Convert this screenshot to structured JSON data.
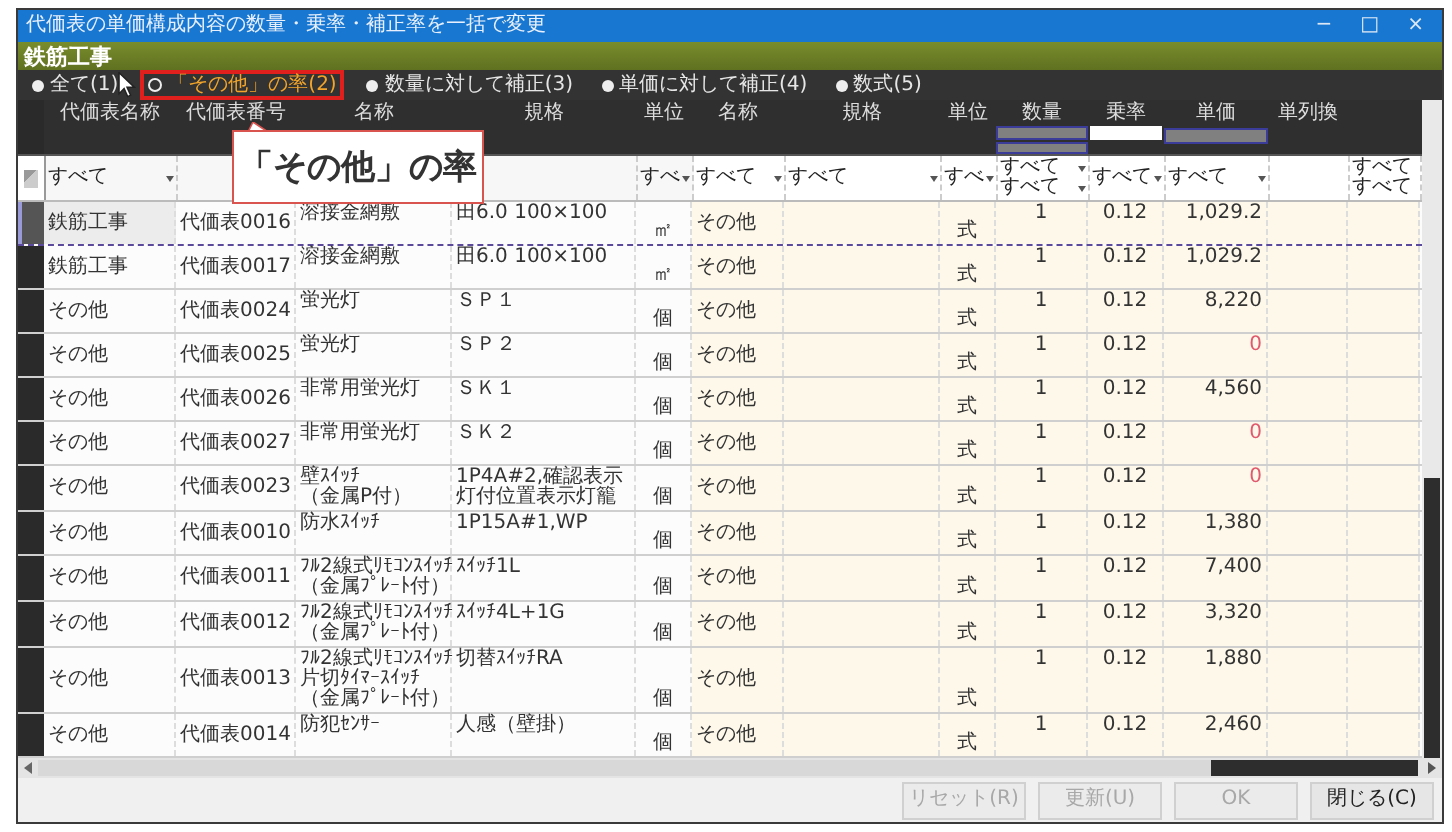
{
  "window": {
    "title": "代価表の単価構成内容の数量・乗率・補正率を一括で変更",
    "controls": [
      "−",
      "□",
      "×"
    ]
  },
  "category": "鉄筋工事",
  "modes": [
    {
      "label": "全て(1)",
      "selected": false,
      "highlighted": false
    },
    {
      "label": "「その他」の率(2)",
      "selected": true,
      "highlighted": true
    },
    {
      "label": "数量に対して補正(3)",
      "selected": false,
      "highlighted": false
    },
    {
      "label": "単価に対して補正(4)",
      "selected": false,
      "highlighted": false
    },
    {
      "label": "数式(5)",
      "selected": false,
      "highlighted": false
    }
  ],
  "callout": "「その他」の率",
  "columns": [
    {
      "label": "代価表名称",
      "filter": [
        "すべて"
      ],
      "filter_arrow": true
    },
    {
      "label": "代価表番号"
    },
    {
      "label": "名称"
    },
    {
      "label": "規格"
    },
    {
      "label": "単位",
      "filter": [
        "すべ"
      ],
      "filter_arrow": true
    },
    {
      "label": "名称",
      "filter": [
        "すべて"
      ],
      "filter_arrow": true
    },
    {
      "label": "規格",
      "filter": [
        "すべて"
      ],
      "filter_arrow": true
    },
    {
      "label": "単位",
      "filter": [
        "すべ"
      ],
      "filter_arrow": true
    },
    {
      "label": "数量",
      "filter": [
        "すべて",
        "すべて"
      ],
      "filter_arrow": true
    },
    {
      "label": "乗率",
      "filter": [
        "すべて"
      ],
      "filter_arrow": true
    },
    {
      "label": "単価",
      "filter": [
        "すべて"
      ],
      "filter_arrow": true
    },
    {
      "label": "単列換"
    },
    {
      "filter": [
        "すべて",
        "すべて"
      ],
      "filter_arrow": false
    }
  ],
  "rows": [
    {
      "group": "鉄筋工事",
      "code": "代価表0016",
      "name": [
        "溶接金網敷"
      ],
      "spec": "田6.0 100×100",
      "unit": "㎡",
      "item_name": "その他",
      "item_unit": "式",
      "quantity": "1",
      "rate": "0.12",
      "price": "1,029.2",
      "color": "#333333",
      "selected": true
    },
    {
      "group": "鉄筋工事",
      "code": "代価表0017",
      "name": [
        "溶接金網敷"
      ],
      "spec": "田6.0 100×100",
      "unit": "㎡",
      "item_name": "その他",
      "item_unit": "式",
      "quantity": "1",
      "rate": "0.12",
      "price": "1,029.2",
      "color": "#333333",
      "selected": false
    },
    {
      "group": "その他",
      "code": "代価表0024",
      "name": [
        "蛍光灯"
      ],
      "spec": "ＳＰ１",
      "unit": "個",
      "item_name": "その他",
      "item_unit": "式",
      "quantity": "1",
      "rate": "0.12",
      "price": "8,220",
      "color": "#333333",
      "selected": false
    },
    {
      "group": "その他",
      "code": "代価表0025",
      "name": [
        "蛍光灯"
      ],
      "spec": "ＳＰ２",
      "unit": "個",
      "item_name": "その他",
      "item_unit": "式",
      "quantity": "1",
      "rate": "0.12",
      "price": "0",
      "color": "#e05a6e",
      "selected": false
    },
    {
      "group": "その他",
      "code": "代価表0026",
      "name": [
        "非常用蛍光灯"
      ],
      "spec": "ＳＫ１",
      "unit": "個",
      "item_name": "その他",
      "item_unit": "式",
      "quantity": "1",
      "rate": "0.12",
      "price": "4,560",
      "color": "#333333",
      "selected": false
    },
    {
      "group": "その他",
      "code": "代価表0027",
      "name": [
        "非常用蛍光灯"
      ],
      "spec": "ＳＫ２",
      "unit": "個",
      "item_name": "その他",
      "item_unit": "式",
      "quantity": "1",
      "rate": "0.12",
      "price": "0",
      "color": "#e05a6e",
      "selected": false
    },
    {
      "group": "その他",
      "code": "代価表0023",
      "name": [
        "壁ｽｲｯﾁ",
        "（金属P付）"
      ],
      "spec": "1P4A#2,確認表示灯付位置表示灯籠",
      "unit": "個",
      "item_name": "その他",
      "item_unit": "式",
      "quantity": "1",
      "rate": "0.12",
      "price": "0",
      "color": "#e05a6e",
      "selected": false
    },
    {
      "group": "その他",
      "code": "代価表0010",
      "name": [
        "防水ｽｲｯﾁ"
      ],
      "spec": "1P15A#1,WP",
      "unit": "個",
      "item_name": "その他",
      "item_unit": "式",
      "quantity": "1",
      "rate": "0.12",
      "price": "1,380",
      "color": "#333333",
      "selected": false
    },
    {
      "group": "その他",
      "code": "代価表0011",
      "name": [
        "ﾌﾙ2線式ﾘﾓｺﾝｽｲｯﾁ",
        "（金属ﾌﾟﾚｰﾄ付）"
      ],
      "spec": "ｽｲｯﾁ1L",
      "unit": "個",
      "item_name": "その他",
      "item_unit": "式",
      "quantity": "1",
      "rate": "0.12",
      "price": "7,400",
      "color": "#333333",
      "selected": false
    },
    {
      "group": "その他",
      "code": "代価表0012",
      "name": [
        "ﾌﾙ2線式ﾘﾓｺﾝｽｲｯﾁ",
        "（金属ﾌﾟﾚｰﾄ付）"
      ],
      "spec": "ｽｲｯﾁ4L+1G",
      "unit": "個",
      "item_name": "その他",
      "item_unit": "式",
      "quantity": "1",
      "rate": "0.12",
      "price": "3,320",
      "color": "#333333",
      "selected": false
    },
    {
      "group": "その他",
      "code": "代価表0013",
      "name": [
        "ﾌﾙ2線式ﾘﾓｺﾝｽｲｯﾁ",
        "片切ﾀｲﾏｰｽｲｯﾁ",
        "（金属ﾌﾟﾚｰﾄ付）"
      ],
      "spec": "切替ｽｲｯﾁRA",
      "unit": "個",
      "item_name": "その他",
      "item_unit": "式",
      "quantity": "1",
      "rate": "0.12",
      "price": "1,880",
      "color": "#333333",
      "selected": false
    },
    {
      "group": "その他",
      "code": "代価表0014",
      "name": [
        "防犯ｾﾝｻｰ"
      ],
      "spec": "人感（壁掛）",
      "unit": "個",
      "item_name": "その他",
      "item_unit": "式",
      "quantity": "1",
      "rate": "0.12",
      "price": "2,460",
      "color": "#333333",
      "selected": false
    }
  ],
  "buttons": [
    {
      "label": "リセット(R)",
      "disabled": true
    },
    {
      "label": "更新(U)",
      "disabled": true
    },
    {
      "label": "OK",
      "disabled": true
    },
    {
      "label": "閉じる(C)",
      "disabled": false
    }
  ]
}
